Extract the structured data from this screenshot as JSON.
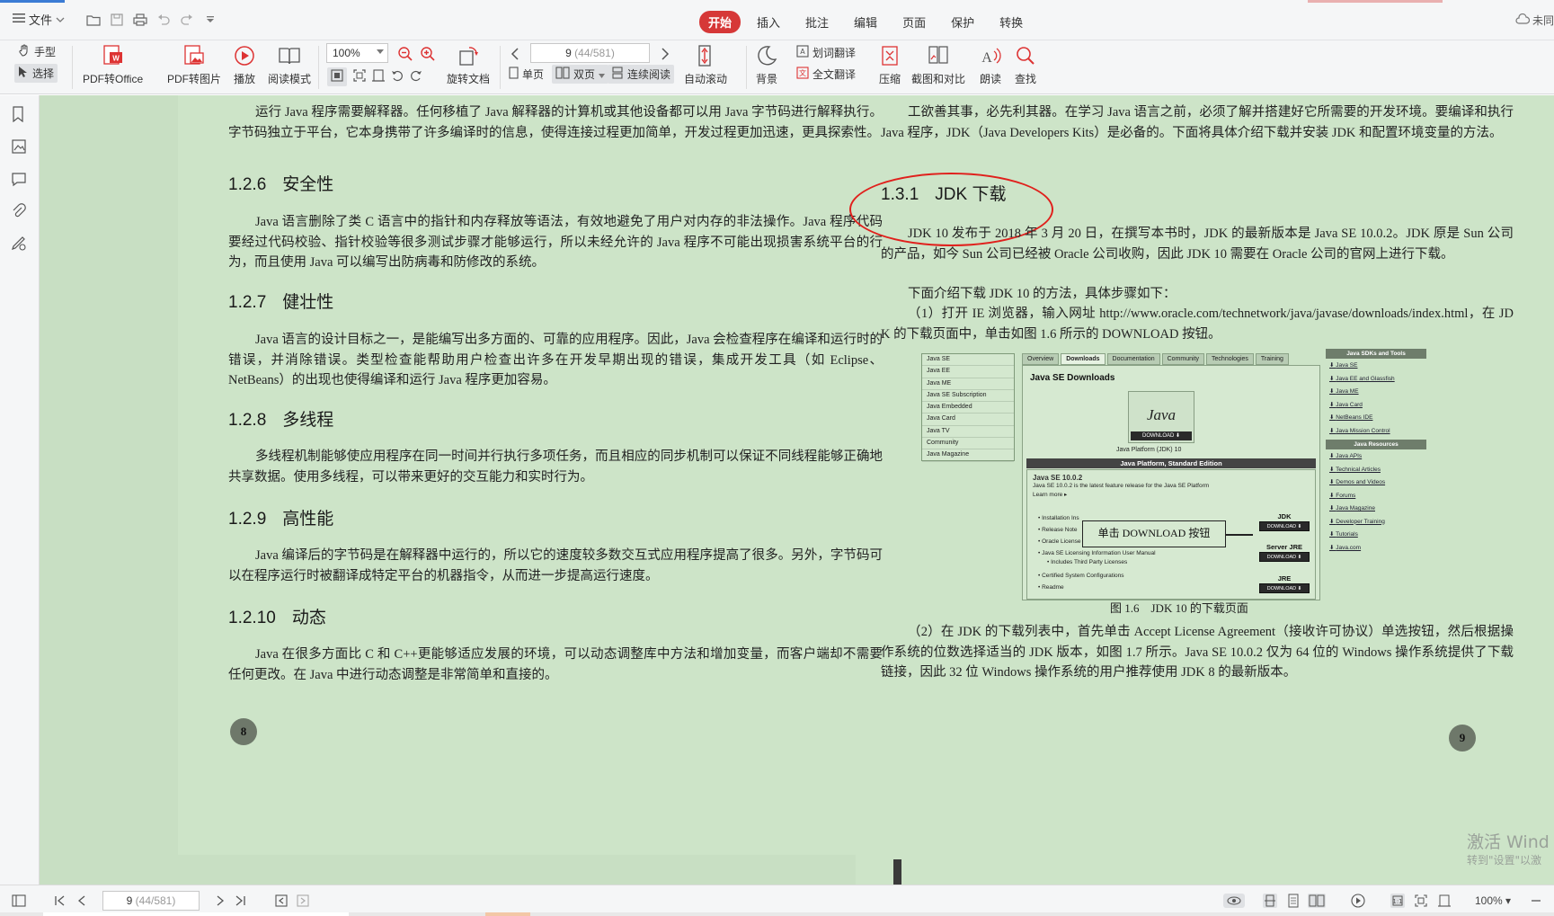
{
  "menubar": {
    "file_label": "文件",
    "tabs": [
      {
        "label": "开始",
        "active": true
      },
      {
        "label": "插入",
        "active": false
      },
      {
        "label": "批注",
        "active": false
      },
      {
        "label": "编辑",
        "active": false
      },
      {
        "label": "页面",
        "active": false
      },
      {
        "label": "保护",
        "active": false
      },
      {
        "label": "转换",
        "active": false
      }
    ],
    "cloud_label": "未同"
  },
  "ribbon": {
    "hand_label": "手型",
    "select_label": "选择",
    "pdf_to_office": "PDF转Office",
    "pdf_to_image": "PDF转图片",
    "play": "播放",
    "reading_mode": "阅读模式",
    "zoom_value": "100%",
    "rotate_doc": "旋转文档",
    "page_current": "9",
    "page_total": "(44/581)",
    "single_page": "单页",
    "double_page": "双页",
    "continuous": "连续阅读",
    "auto_scroll": "自动滚动",
    "background": "背景",
    "word_translate": "划词翻译",
    "full_translate": "全文翻译",
    "compress": "压缩",
    "screenshot_compare": "截图和对比",
    "read_aloud": "朗读",
    "find": "查找"
  },
  "left_page": {
    "intro": "运行 Java 程序需要解释器。任何移植了 Java 解释器的计算机或其他设备都可以用 Java 字节码进行解释执行。字节码独立于平台，它本身携带了许多编译时的信息，使得连接过程更加简单，开发过程更加迅速，更具探索性。",
    "sections": [
      {
        "num": "1.2.6",
        "title": "安全性",
        "body": "Java 语言删除了类 C 语言中的指针和内存释放等语法，有效地避免了用户对内存的非法操作。Java 程序代码要经过代码校验、指针校验等很多测试步骤才能够运行，所以未经允许的 Java 程序不可能出现损害系统平台的行为，而且使用 Java 可以编写出防病毒和防修改的系统。"
      },
      {
        "num": "1.2.7",
        "title": "健壮性",
        "body": "Java 语言的设计目标之一，是能编写出多方面的、可靠的应用程序。因此，Java 会检查程序在编译和运行时的错误，并消除错误。类型检查能帮助用户检查出许多在开发早期出现的错误，集成开发工具（如 Eclipse、NetBeans）的出现也使得编译和运行 Java 程序更加容易。"
      },
      {
        "num": "1.2.8",
        "title": "多线程",
        "body": "多线程机制能够使应用程序在同一时间并行执行多项任务，而且相应的同步机制可以保证不同线程能够正确地共享数据。使用多线程，可以带来更好的交互能力和实时行为。"
      },
      {
        "num": "1.2.9",
        "title": "高性能",
        "body": "Java 编译后的字节码是在解释器中运行的，所以它的速度较多数交互式应用程序提高了很多。另外，字节码可以在程序运行时被翻译成特定平台的机器指令，从而进一步提高运行速度。"
      },
      {
        "num": "1.2.10",
        "title": "动态",
        "body": "Java 在很多方面比 C 和 C++更能够适应发展的环境，可以动态调整库中方法和增加变量，而客户端却不需要任何更改。在 Java 中进行动态调整是非常简单和直接的。"
      }
    ],
    "page_number": "8"
  },
  "right_page": {
    "intro": "工欲善其事，必先利其器。在学习 Java 语言之前，必须了解并搭建好它所需要的开发环境。要编译和执行 Java 程序，JDK（Java Developers Kits）是必备的。下面将具体介绍下载并安装 JDK 和配置环境变量的方法。",
    "heading_num": "1.3.1",
    "heading_title": "JDK 下载",
    "p1": "JDK 10 发布于 2018 年 3 月 20 日，在撰写本书时，JDK 的最新版本是 Java SE 10.0.2。JDK 原是 Sun 公司的产品，如今 Sun 公司已经被 Oracle 公司收购，因此 JDK 10 需要在 Oracle 公司的官网上进行下载。",
    "p2": "下面介绍下载 JDK 10 的方法，具体步骤如下：",
    "p3": "（1）打开 IE 浏览器，输入网址 http://www.oracle.com/technetwork/java/javase/downloads/index.html，在 JDK 的下载页面中，单击如图 1.6 所示的 DOWNLOAD 按钮。",
    "figure": {
      "left_list": [
        "Java SE",
        "Java EE",
        "Java ME",
        "Java SE Subscription",
        "Java Embedded",
        "Java Card",
        "Java TV",
        "Community",
        "Java Magazine"
      ],
      "tabs": [
        "Overview",
        "Downloads",
        "Documentation",
        "Community",
        "Technologies",
        "Training"
      ],
      "title": "Java SE Downloads",
      "logo_word": "Java",
      "logo_button": "DOWNLOAD ⬇",
      "logo_caption": "Java Platform (JDK) 10",
      "platform_bar": "Java Platform, Standard Edition",
      "version_head": "Java SE 10.0.2",
      "version_sub": "Java SE 10.0.2 is the latest feature release for the Java SE Platform",
      "learn_more": "Learn more ▸",
      "items": [
        "Installation Ins",
        "Release Note",
        "Oracle License",
        "Java SE Licensing Information User Manual",
        "Includes Third Party Licenses",
        "Certified System Configurations",
        "Readme"
      ],
      "callout": "单击 DOWNLOAD 按钮",
      "dl_jdk": "JDK",
      "dl_server_jre": "Server JRE",
      "dl_jre": "JRE",
      "dl_button": "DOWNLOAD ⬇",
      "right_head1": "Java SDKs and Tools",
      "right_links1": [
        "Java SE",
        "Java EE and Glassfish",
        "Java ME",
        "Java Card",
        "NetBeans IDE",
        "Java Mission Control"
      ],
      "right_head2": "Java Resources",
      "right_links2": [
        "Java APIs",
        "Technical Articles",
        "Demos and Videos",
        "Forums",
        "Java Magazine",
        "Developer Training",
        "Tutorials",
        "Java.com"
      ]
    },
    "caption": "图 1.6　JDK 10 的下载页面",
    "p4": "（2）在 JDK 的下载列表中，首先单击 Accept License Agreement（接收许可协议）单选按钮，然后根据操作系统的位数选择适当的 JDK 版本，如图 1.7 所示。Java SE 10.0.2 仅为 64 位的 Windows 操作系统提供了下载链接，因此 32 位 Windows 操作系统的用户推荐使用 JDK 8 的最新版本。",
    "page_number": "9"
  },
  "statusbar": {
    "page_current": "9",
    "page_total": "(44/581)",
    "zoom": "100%"
  },
  "watermark": {
    "line1": "激活 Wind",
    "line2": "转到\"设置\"以激"
  },
  "colors": {
    "active_tab": "#d63838",
    "page_bg": "#cde4c8",
    "annotation": "#e0201c"
  }
}
